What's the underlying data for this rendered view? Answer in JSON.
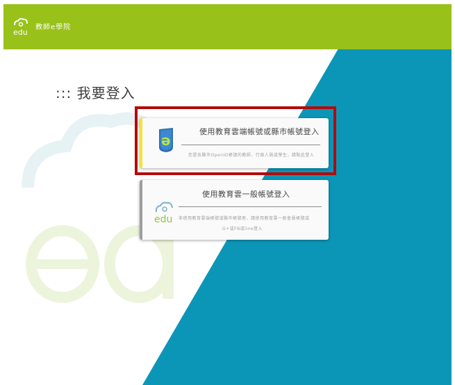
{
  "header": {
    "site_name": "教師e學院",
    "logo_icon": "edu-cloud-logo-icon",
    "bg_color": "#98c11a"
  },
  "main": {
    "heading": "::: 我要登入",
    "accent_blue": "#0b96b8"
  },
  "login_options": [
    {
      "title": "使用教育雲端帳號或縣市帳號登入",
      "description": "您是各縣市OpenID帳號的教師、行政人員或學生，請點此登入",
      "icon": "openid-badge-icon"
    },
    {
      "title": "使用教育雲一般帳號登入",
      "description_line1": "非使用教育雲端帳號或縣市帳號者，請使用教育雲一般會員帳號或",
      "description_line2": "G+或FB或line登入",
      "icon": "edu-cloud-icon"
    }
  ]
}
